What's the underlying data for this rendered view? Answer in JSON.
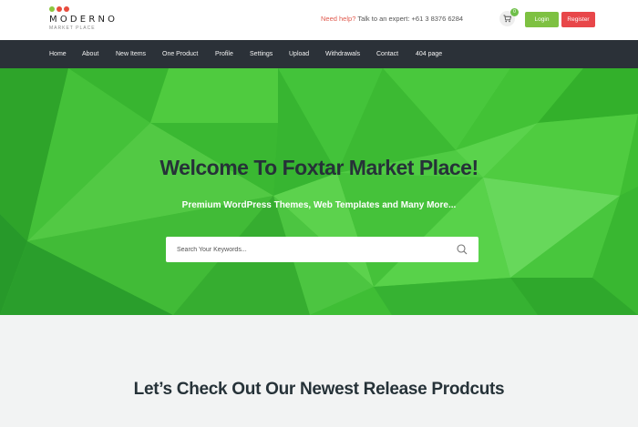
{
  "brand": {
    "name": "MODERNO",
    "tagline": "MARKET PLACE",
    "dot_colors": [
      "#8cc63f",
      "#e84c3d",
      "#e84c3d"
    ]
  },
  "header": {
    "help_label": "Need help?",
    "help_text": "Talk to an expert: +61 3 8376 6284",
    "cart_icon": "cart-icon",
    "cart_count": "0",
    "login_label": "Login",
    "register_label": "Register"
  },
  "nav": {
    "items": [
      "Home",
      "About",
      "New Items",
      "One Product",
      "Profile",
      "Settings",
      "Upload",
      "Withdrawals",
      "Contact",
      "404 page"
    ]
  },
  "hero": {
    "title": "Welcome To Foxtar Market Place!",
    "subtitle": "Premium WordPress Themes, Web Templates and Many More...",
    "search_placeholder": "Search Your Keywords...",
    "search_icon": "search-icon"
  },
  "section": {
    "title": "Let’s Check Out Our Newest Release Prodcuts"
  },
  "colors": {
    "accent_green": "#7ec142",
    "register_red": "#e8474a",
    "nav_bg": "#2b3138",
    "hero_green": "#3fbf32"
  }
}
